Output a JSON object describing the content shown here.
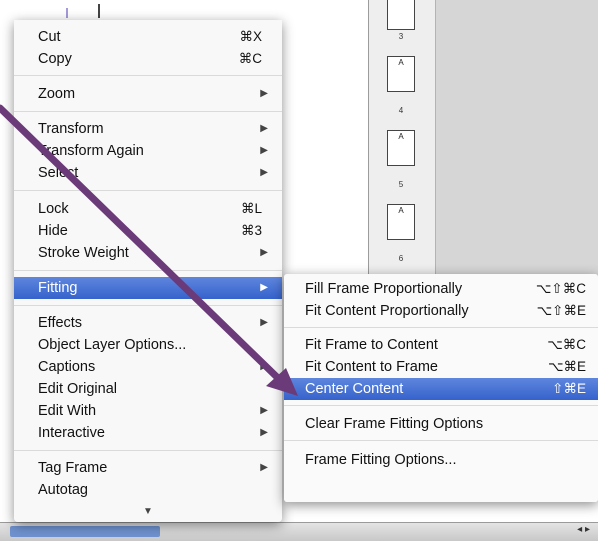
{
  "pages_panel": {
    "thumbnails": [
      {
        "letter": "",
        "number": "3"
      },
      {
        "letter": "A",
        "number": "4"
      },
      {
        "letter": "A",
        "number": "5"
      },
      {
        "letter": "A",
        "number": "6"
      }
    ]
  },
  "context_menu": {
    "items": [
      {
        "label": "Cut",
        "shortcut": "⌘X"
      },
      {
        "label": "Copy",
        "shortcut": "⌘C"
      },
      {
        "label": "Zoom"
      },
      {
        "label": "Transform"
      },
      {
        "label": "Transform Again"
      },
      {
        "label": "Select"
      },
      {
        "label": "Lock",
        "shortcut": "⌘L"
      },
      {
        "label": "Hide",
        "shortcut": "⌘3"
      },
      {
        "label": "Stroke Weight"
      },
      {
        "label": "Fitting"
      },
      {
        "label": "Effects"
      },
      {
        "label": "Object Layer Options..."
      },
      {
        "label": "Captions"
      },
      {
        "label": "Edit Original"
      },
      {
        "label": "Edit With"
      },
      {
        "label": "Interactive"
      },
      {
        "label": "Tag Frame"
      },
      {
        "label": "Autotag"
      }
    ],
    "submenu_arrow": "▶",
    "scroll_down_indicator": "▼"
  },
  "fitting_submenu": {
    "items": [
      {
        "label": "Fill Frame Proportionally",
        "shortcut": "⌥⇧⌘C"
      },
      {
        "label": "Fit Content Proportionally",
        "shortcut": "⌥⇧⌘E"
      },
      {
        "label": "Fit Frame to Content",
        "shortcut": "⌥⌘C"
      },
      {
        "label": "Fit Content to Frame",
        "shortcut": "⌥⌘E"
      },
      {
        "label": "Center Content",
        "shortcut": "⇧⌘E"
      },
      {
        "label": "Clear Frame Fitting Options"
      },
      {
        "label": "Frame Fitting Options..."
      }
    ]
  },
  "colors": {
    "highlight": "#3563cc",
    "annotation_arrow": "#6b3a78"
  },
  "bottom_bar": {
    "scroll_arrows": "◂ ▸"
  }
}
